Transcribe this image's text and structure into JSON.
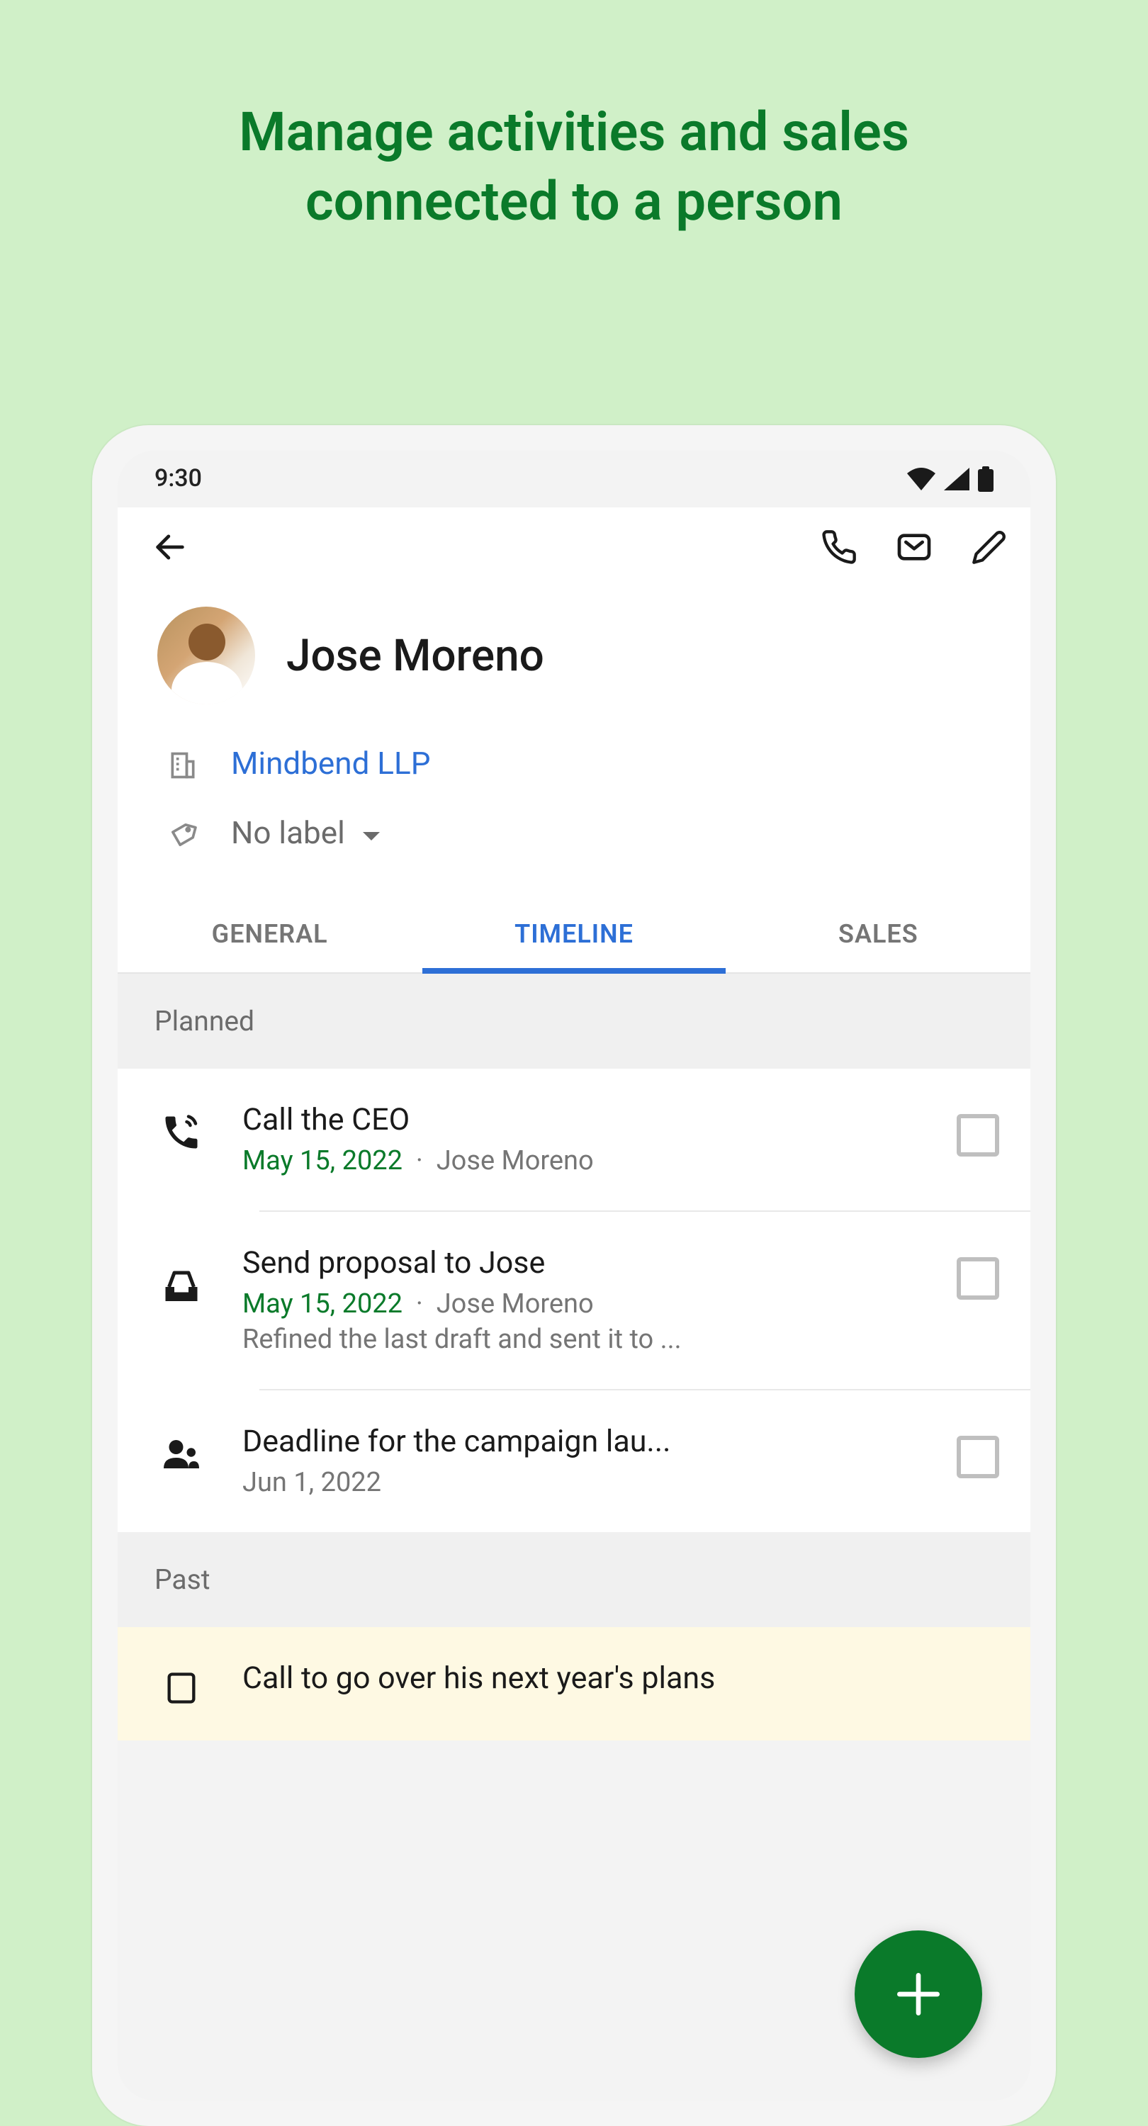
{
  "headline_line1": "Manage activities and sales",
  "headline_line2": "connected to a person",
  "status": {
    "time": "9:30"
  },
  "contact": {
    "name": "Jose Moreno",
    "company": "Mindbend LLP",
    "label": "No label"
  },
  "tabs": {
    "general": "GENERAL",
    "timeline": "TIMELINE",
    "sales": "SALES"
  },
  "sections": {
    "planned": "Planned",
    "past": "Past"
  },
  "activities": [
    {
      "title": "Call the CEO",
      "date": "May 15, 2022",
      "person": "Jose Moreno",
      "note": "",
      "icon": "phone"
    },
    {
      "title": "Send proposal to Jose",
      "date": "May 15, 2022",
      "person": "Jose Moreno",
      "note": "Refined the last draft and sent it to ...",
      "icon": "inbox"
    },
    {
      "title": "Deadline for the campaign lau...",
      "date": "Jun 1, 2022",
      "person": "",
      "note": "",
      "icon": "people"
    }
  ],
  "past_activity": {
    "title": "Call to go over his next year's plans"
  }
}
